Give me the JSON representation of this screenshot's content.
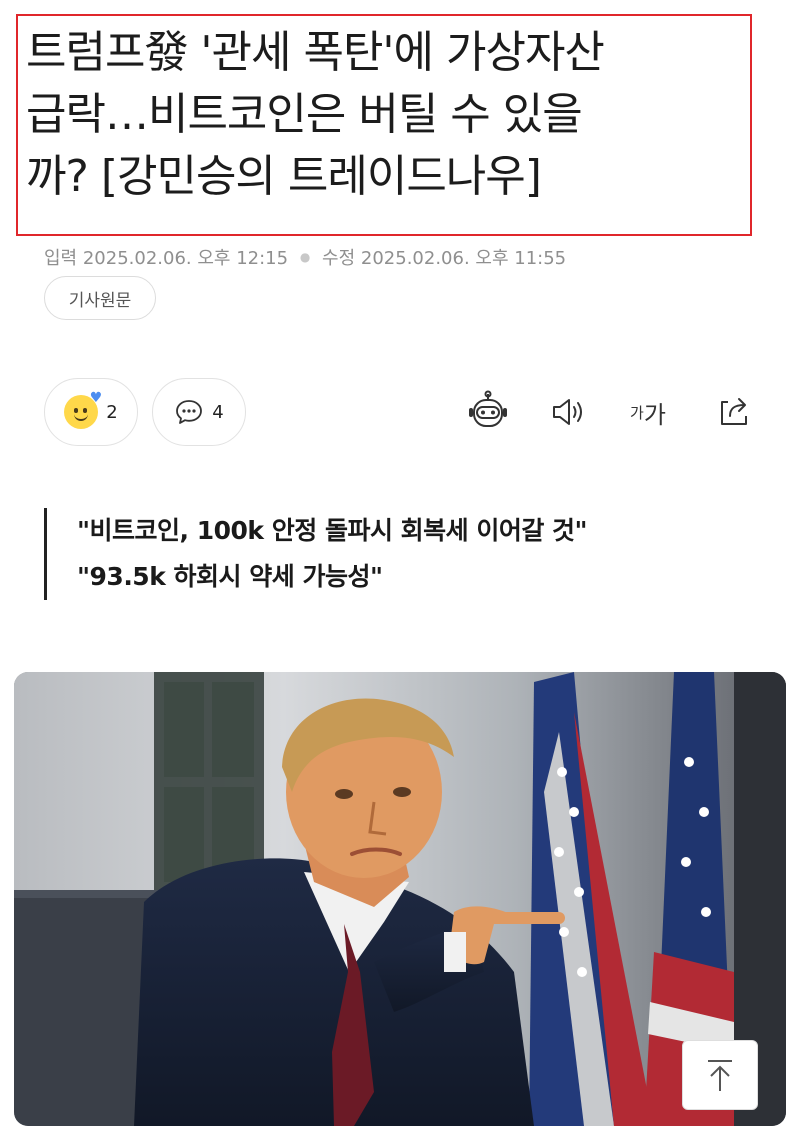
{
  "article": {
    "headline_lines": [
      "트럼프發 '관세 폭탄'에 가상자산",
      "급락…비트코인은 버틸 수 있을",
      "까? [강민승의 트레이드나우]"
    ],
    "meta": {
      "input_label": "입력",
      "input_time": "2025.02.06. 오후 12:15",
      "modified_label": "수정",
      "modified_time": "2025.02.06. 오후 11:55"
    },
    "origin_button": "기사원문",
    "reactions": {
      "count": "2"
    },
    "comments": {
      "count": "4"
    },
    "tools": {
      "bot": "robot-icon",
      "speaker": "speaker-icon",
      "font_small": "가",
      "font_large": "가",
      "share": "share-icon"
    },
    "quote_lines": [
      "\"비트코인, 100k 안정 돌파시 회복세 이어갈 것\"",
      "\"93.5k 하회시 약세 가능성\""
    ]
  },
  "colors": {
    "highlight_border": "#e0262b",
    "meta_text": "#8f8f8f"
  }
}
